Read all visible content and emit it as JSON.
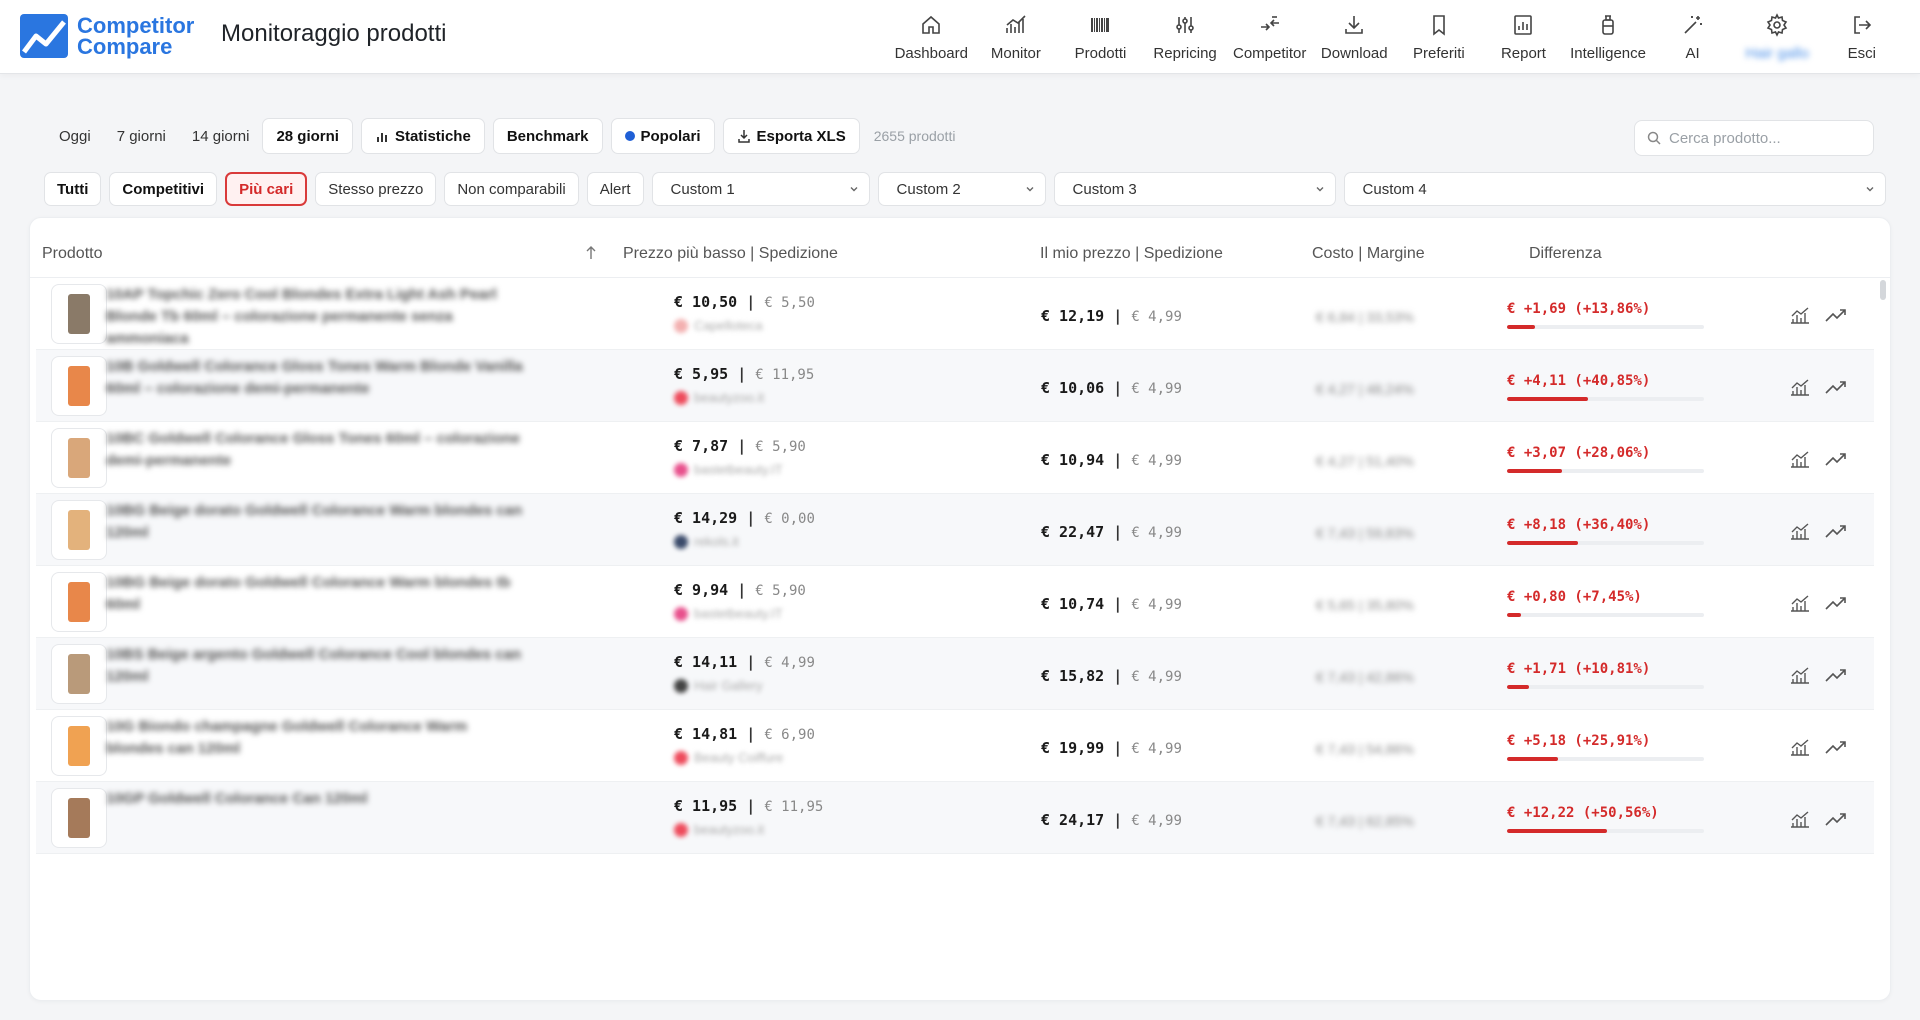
{
  "app": {
    "name_line1": "Competitor",
    "name_line2": "Compare",
    "page_title": "Monitoraggio prodotti",
    "brand_color": "#2a76e0"
  },
  "nav": [
    {
      "label": "Dashboard",
      "icon": "home-icon"
    },
    {
      "label": "Monitor",
      "icon": "chart-line-icon"
    },
    {
      "label": "Prodotti",
      "icon": "barcode-icon"
    },
    {
      "label": "Repricing",
      "icon": "sliders-icon"
    },
    {
      "label": "Competitor",
      "icon": "arrows-compare-icon"
    },
    {
      "label": "Download",
      "icon": "download-icon"
    },
    {
      "label": "Preferiti",
      "icon": "bookmark-icon"
    },
    {
      "label": "Report",
      "icon": "report-icon"
    },
    {
      "label": "Intelligence",
      "icon": "flask-icon"
    },
    {
      "label": "AI",
      "icon": "magic-wand-icon"
    },
    {
      "label": "Hair gallo",
      "icon": "gear-icon"
    },
    {
      "label": "Esci",
      "icon": "logout-icon"
    }
  ],
  "periods": [
    "Oggi",
    "7 giorni",
    "14 giorni",
    "28 giorni"
  ],
  "active_period": "28 giorni",
  "toolbar": {
    "stats": "Statistiche",
    "benchmark": "Benchmark",
    "popular": "Popolari",
    "export": "Esporta XLS",
    "count": "2655 prodotti"
  },
  "search": {
    "placeholder": "Cerca prodotto..."
  },
  "filters": [
    "Tutti",
    "Competitivi",
    "Più cari",
    "Stesso prezzo",
    "Non comparabili",
    "Alert"
  ],
  "active_filter": "Più cari",
  "custom_selects": [
    "Custom 1",
    "Custom 2",
    "Custom 3",
    "Custom 4"
  ],
  "columns": {
    "product": "Prodotto",
    "lowest": "Prezzo più basso | Spedizione",
    "mine": "Il mio prezzo | Spedizione",
    "cost": "Costo | Margine",
    "diff": "Differenza"
  },
  "rows": [
    {
      "name": "10AP Topchic Zero Cool Blondes Extra Light Ash Pearl Blonde Tb 60ml – colorazione permanente senza ammoniaca",
      "lowest": "€ 10,50",
      "lowest_ship": "€ 5,50",
      "seller": "Capelloteca",
      "seller_color": "#f3b0b0",
      "mine": "€ 12,19",
      "mine_ship": "€ 4,99",
      "cost": "€ 6,84 | 33,53%",
      "diff": "€ +1,69 (+13,86%)",
      "diff_fraction": 0.14,
      "thumb_color": "#8a7a68"
    },
    {
      "name": "10B Goldwell Colorance Gloss Tones Warm Blonde Vanilla 60ml – colorazione demi-permanente",
      "lowest": "€ 5,95",
      "lowest_ship": "€ 11,95",
      "seller": "beautyzoo.it",
      "seller_color": "#ee4b5c",
      "mine": "€ 10,06",
      "mine_ship": "€ 4,99",
      "cost": "€ 4,27 | 48,24%",
      "diff": "€ +4,11 (+40,85%)",
      "diff_fraction": 0.41,
      "thumb_color": "#e8874a"
    },
    {
      "name": "10BC Goldwell Colorance Gloss Tones 60ml – colorazione demi-permanente",
      "lowest": "€ 7,87",
      "lowest_ship": "€ 5,90",
      "seller": "bastetbeauty.IT",
      "seller_color": "#e8508c",
      "mine": "€ 10,94",
      "mine_ship": "€ 4,99",
      "cost": "€ 4,27 | 51,40%",
      "diff": "€ +3,07 (+28,06%)",
      "diff_fraction": 0.28,
      "thumb_color": "#d9a77a"
    },
    {
      "name": "10BG Beige dorato Goldwell Colorance Warm blondes can 120ml",
      "lowest": "€ 14,29",
      "lowest_ship": "€ 0,00",
      "seller": "rekols.it",
      "seller_color": "#3a4a6a",
      "mine": "€ 22,47",
      "mine_ship": "€ 4,99",
      "cost": "€ 7,43 | 59,83%",
      "diff": "€ +8,18 (+36,40%)",
      "diff_fraction": 0.36,
      "thumb_color": "#e3b27c"
    },
    {
      "name": "10BG Beige dorato Goldwell Colorance Warm blondes tb 60ml",
      "lowest": "€ 9,94",
      "lowest_ship": "€ 5,90",
      "seller": "bastetbeauty.IT",
      "seller_color": "#e8508c",
      "mine": "€ 10,74",
      "mine_ship": "€ 4,99",
      "cost": "€ 5,65 | 35,80%",
      "diff": "€ +0,80 (+7,45%)",
      "diff_fraction": 0.07,
      "thumb_color": "#e8874a"
    },
    {
      "name": "10BS Beige argento Goldwell Colorance Cool blondes can 120ml",
      "lowest": "€ 14,11",
      "lowest_ship": "€ 4,99",
      "seller": "Hair Gallery",
      "seller_color": "#444444",
      "mine": "€ 15,82",
      "mine_ship": "€ 4,99",
      "cost": "€ 7,43 | 42,86%",
      "diff": "€ +1,71 (+10,81%)",
      "diff_fraction": 0.11,
      "thumb_color": "#b99a7a"
    },
    {
      "name": "10G Biondo champagne Goldwell Colorance Warm blondes can 120ml",
      "lowest": "€ 14,81",
      "lowest_ship": "€ 6,90",
      "seller": "Beauty Coiffure",
      "seller_color": "#ee4b5c",
      "mine": "€ 19,99",
      "mine_ship": "€ 4,99",
      "cost": "€ 7,43 | 54,86%",
      "diff": "€ +5,18 (+25,91%)",
      "diff_fraction": 0.26,
      "thumb_color": "#f0a252"
    },
    {
      "name": "10GP Goldwell Colorance Can 120ml",
      "lowest": "€ 11,95",
      "lowest_ship": "€ 11,95",
      "seller": "beautyzoo.it",
      "seller_color": "#ee4b5c",
      "mine": "€ 24,17",
      "mine_ship": "€ 4,99",
      "cost": "€ 7,43 | 62,85%",
      "diff": "€ +12,22 (+50,56%)",
      "diff_fraction": 0.51,
      "thumb_color": "#a57a5a"
    }
  ]
}
